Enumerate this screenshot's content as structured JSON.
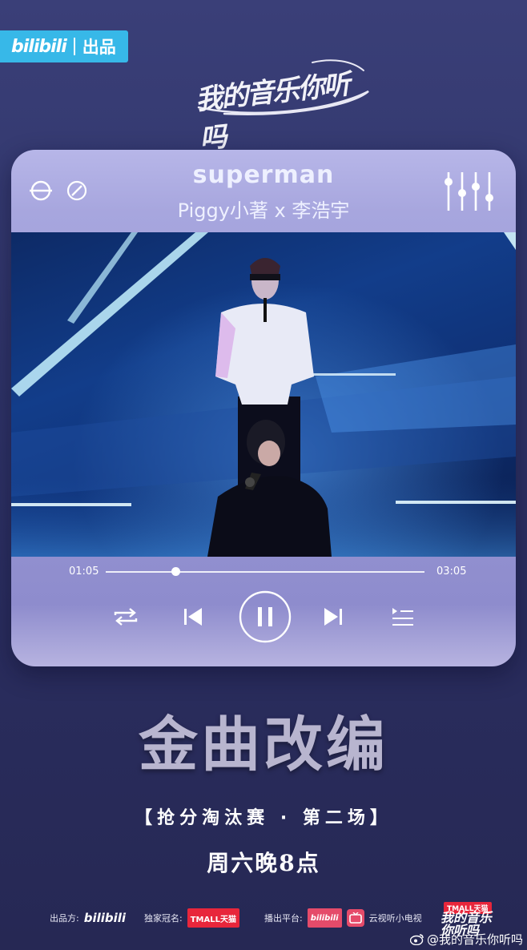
{
  "header": {
    "platform_brand": "bilibili",
    "platform_suffix": "出品",
    "show_logo": "我的音乐你听吗"
  },
  "player": {
    "song_title": "superman",
    "artist": "Piggy小著 x 李浩宇",
    "current_time": "01:05",
    "total_time": "03:05",
    "progress": 0.22,
    "icons": {
      "left_1": "no-loop-icon",
      "left_2": "forbidden-icon",
      "right": "equalizer-icon",
      "controls": [
        "repeat-icon",
        "previous-icon",
        "pause-icon",
        "next-icon",
        "playlist-icon"
      ]
    }
  },
  "promo": {
    "headline": "金曲改编",
    "subtitle": "【抢分淘汰赛 · 第二场】",
    "air_time": "周六晚8点"
  },
  "footer": {
    "producer_label": "出品方:",
    "producer_name": "bilibili",
    "sponsor_label": "独家冠名:",
    "sponsor_name": "TMALL天猫",
    "broadcast_label": "播出平台:",
    "broadcast_name_1": "bilibili",
    "broadcast_name_2": "云视听小电视",
    "corner_tag": "TMALL天猫",
    "corner_name": "我的音乐你听吗",
    "weibo_handle": "@我的音乐你听吗"
  },
  "colors": {
    "background": "#30356a",
    "player_card": "#a7a6de",
    "bilibili_blue": "#37b8e8",
    "tmall_red": "#e8263b"
  }
}
